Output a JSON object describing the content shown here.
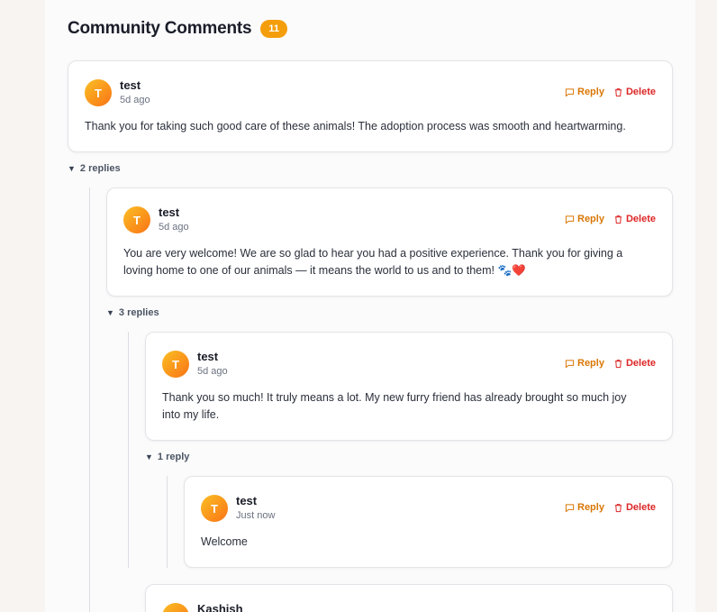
{
  "header": {
    "title": "Community Comments",
    "count": "11"
  },
  "labels": {
    "reply": "Reply",
    "delete": "Delete"
  },
  "comments": [
    {
      "initial": "T",
      "author": "test",
      "time": "5d ago",
      "text": "Thank you for taking such good care of these animals! The adoption process was smooth and heartwarming.",
      "replies_toggle": "2 replies"
    },
    {
      "initial": "T",
      "author": "test",
      "time": "5d ago",
      "text": "You are very welcome! We are so glad to hear you had a positive experience. Thank you for giving a loving home to one of our animals — it means the world to us and to them! 🐾❤️",
      "replies_toggle": "3 replies"
    },
    {
      "initial": "T",
      "author": "test",
      "time": "5d ago",
      "text": "Thank you so much! It truly means a lot. My new furry friend has already brought so much joy into my life.",
      "replies_toggle": "1 reply"
    },
    {
      "initial": "T",
      "author": "test",
      "time": "Just now",
      "text": "Welcome"
    },
    {
      "initial": "K",
      "author": "Kashish"
    }
  ],
  "colors": {
    "accent": "#f59e0b",
    "reply": "#d97706",
    "delete": "#dc2626"
  }
}
